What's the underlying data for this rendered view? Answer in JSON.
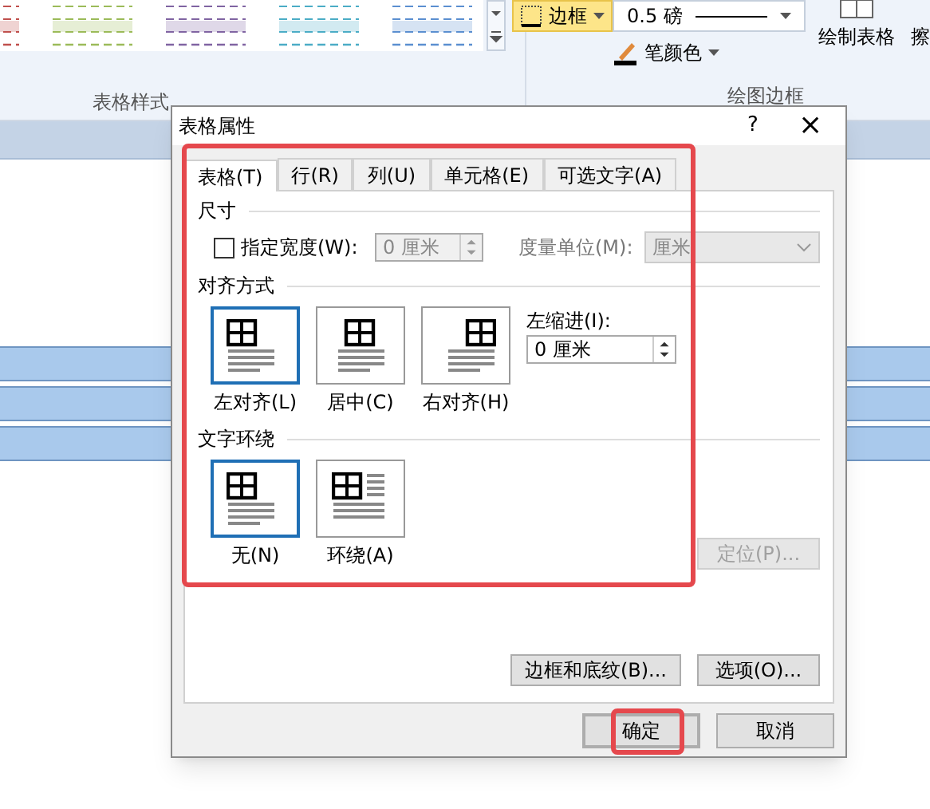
{
  "ribbon": {
    "border_button": "边框",
    "pen_weight": "0.5 磅",
    "pen_color": "笔颜色",
    "draw_table": "绘制表格",
    "eraser": "擦",
    "group_labels": [
      "表格样式",
      "绘图边框"
    ]
  },
  "dialog": {
    "title": "表格属性",
    "help": "?",
    "close": "×",
    "tabs": [
      {
        "label": "表格(T)",
        "selected": true
      },
      {
        "label": "行(R)",
        "selected": false
      },
      {
        "label": "列(U)",
        "selected": false
      },
      {
        "label": "单元格(E)",
        "selected": false
      },
      {
        "label": "可选文字(A)",
        "selected": false
      }
    ],
    "size": {
      "heading": "尺寸",
      "width_label": "指定宽度(W):",
      "checked": false,
      "width_value": "0 厘米",
      "unit_label": "度量单位(M):",
      "unit_value": "厘米",
      "disabled": true
    },
    "alignment": {
      "heading": "对齐方式",
      "options": [
        {
          "label": "左对齐(L)",
          "kind": "left",
          "selected": true
        },
        {
          "label": "居中(C)",
          "kind": "center",
          "selected": false
        },
        {
          "label": "右对齐(H)",
          "kind": "right",
          "selected": false
        }
      ],
      "indent_label": "左缩进(I):",
      "indent_value": "0 厘米"
    },
    "wrapping": {
      "heading": "文字环绕",
      "options": [
        {
          "label": "无(N)",
          "kind": "none",
          "selected": true
        },
        {
          "label": "环绕(A)",
          "kind": "around",
          "selected": false
        }
      ],
      "position_button": {
        "label": "定位(P)...",
        "disabled": true
      }
    },
    "borders_button": "边框和底纹(B)...",
    "options_button": "选项(O)...",
    "ok": "确定",
    "cancel": "取消"
  }
}
